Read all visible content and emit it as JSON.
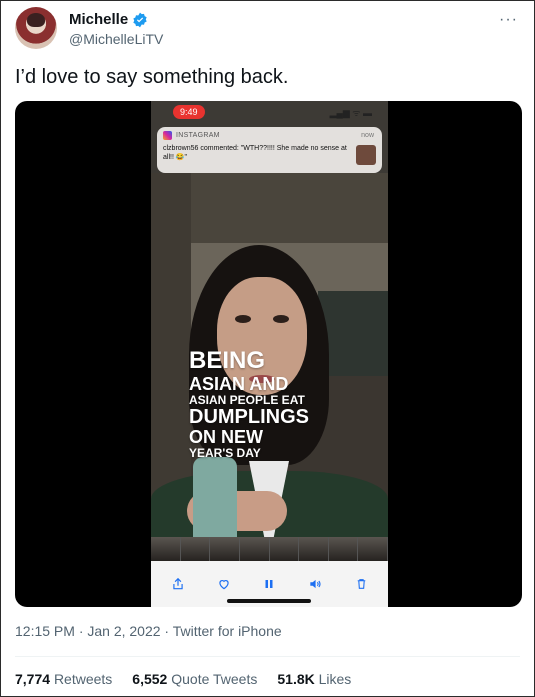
{
  "author": {
    "name": "Michelle",
    "handle": "@MichelleLiTV",
    "verified_icon": "verified-badge-icon",
    "verified_color": "#1d9bf0"
  },
  "tweet": {
    "text": "I’d love to say something back.",
    "timestamp": "12:15 PM · Jan 2, 2022 · Twitter for iPhone"
  },
  "video": {
    "status_time": "9:49",
    "status_icons": "▂▄▆ ᯤ ▬",
    "notification": {
      "app": "INSTAGRAM",
      "time": "now",
      "body": "clzbrown56 commented: \"WTH??!!!! She made no sense at all!! 😂\""
    },
    "caption_lines": [
      "BEING",
      "ASIAN AND",
      "ASIAN PEOPLE EAT",
      "DUMPLINGS",
      "ON NEW",
      "YEAR'S DAY"
    ],
    "controls": [
      "share-icon",
      "heart-icon",
      "pause-icon",
      "volume-icon",
      "trash-icon"
    ],
    "accent_color": "#1d6ff2"
  },
  "stats": {
    "retweets_count": "7,774",
    "retweets_label": "Retweets",
    "quotes_count": "6,552",
    "quotes_label": "Quote Tweets",
    "likes_count": "51.8K",
    "likes_label": "Likes"
  }
}
